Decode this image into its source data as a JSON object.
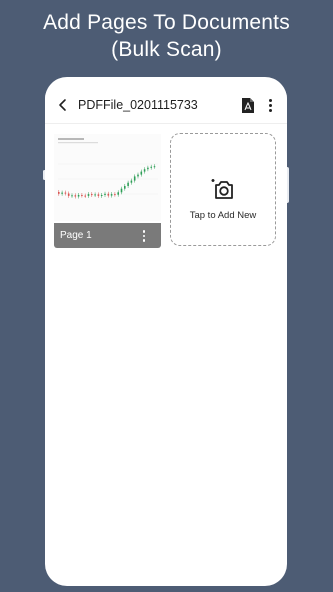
{
  "promo": {
    "headline_line1": "Add Pages To Documents",
    "headline_line2": "(Bulk Scan)"
  },
  "appbar": {
    "back_icon": "back-arrow-icon",
    "title": "PDFFile_0201115733",
    "pdf_icon": "pdf-file-icon",
    "more_icon": "more-vert-icon"
  },
  "pages": [
    {
      "label": "Page 1",
      "thumbnail": "stock-chart-scan",
      "more_icon": "more-vert-icon"
    }
  ],
  "add_card": {
    "icon": "add-camera-icon",
    "label": "Tap to Add New"
  },
  "colors": {
    "background": "#4d5c74",
    "phone": "#ffffff",
    "page_footer": "#7a7a7a",
    "candle_up": "#2e9e57",
    "candle_down": "#d9534f"
  }
}
